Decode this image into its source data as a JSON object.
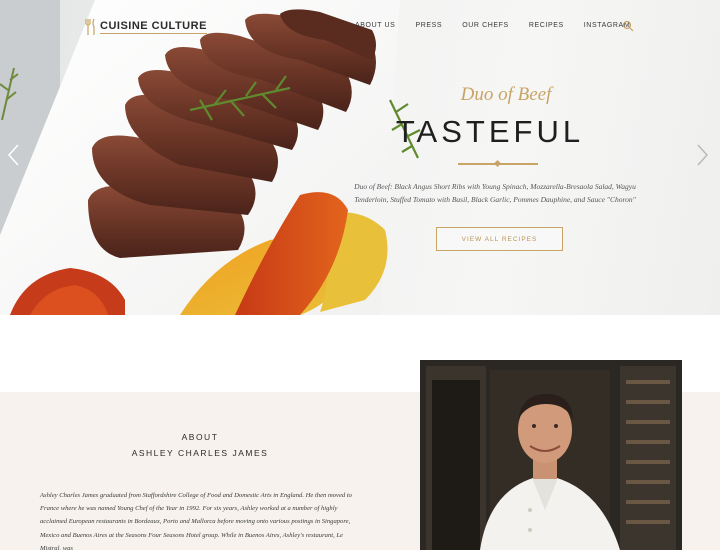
{
  "brand": {
    "name": "CUISINE CULTURE",
    "accent": "#c9a466"
  },
  "nav": {
    "items": [
      {
        "label": "ABOUT US"
      },
      {
        "label": "PRESS"
      },
      {
        "label": "OUR CHEFS"
      },
      {
        "label": "RECIPES"
      },
      {
        "label": "INSTAGRAM"
      }
    ],
    "search_icon": "search-icon"
  },
  "hero": {
    "subtitle": "Duo of Beef",
    "title": "TASTEFUL",
    "description": "Duo of Beef: Black Angus Short Ribs with Young Spinach, Mozzarella-Bresaola Salad, Wagyu Tenderloin, Stuffed Tomato with Basil, Black Garlic, Pommes Dauphine, and Sauce \"Choron\"",
    "button_label": "VIEW ALL RECIPES",
    "prev_icon": "chevron-left-icon",
    "next_icon": "chevron-right-icon"
  },
  "about": {
    "label": "ABOUT",
    "name": "ASHLEY CHARLES JAMES",
    "body": "Ashley Charles James graduated from Staffordshire College of Food and Domestic Arts in England. He then moved to France where he was named Young Chef of the Year in 1992. For six years, Ashley worked at a number of highly acclaimed European restaurants in Bordeaux, Porto and Mallorca before moving onto various postings in Singapore, Mexico and Buenos Aires at the Seasons Four Seasons Hotel group. While in Buenos Aires, Ashley's restaurant, Le Mistral, was"
  }
}
